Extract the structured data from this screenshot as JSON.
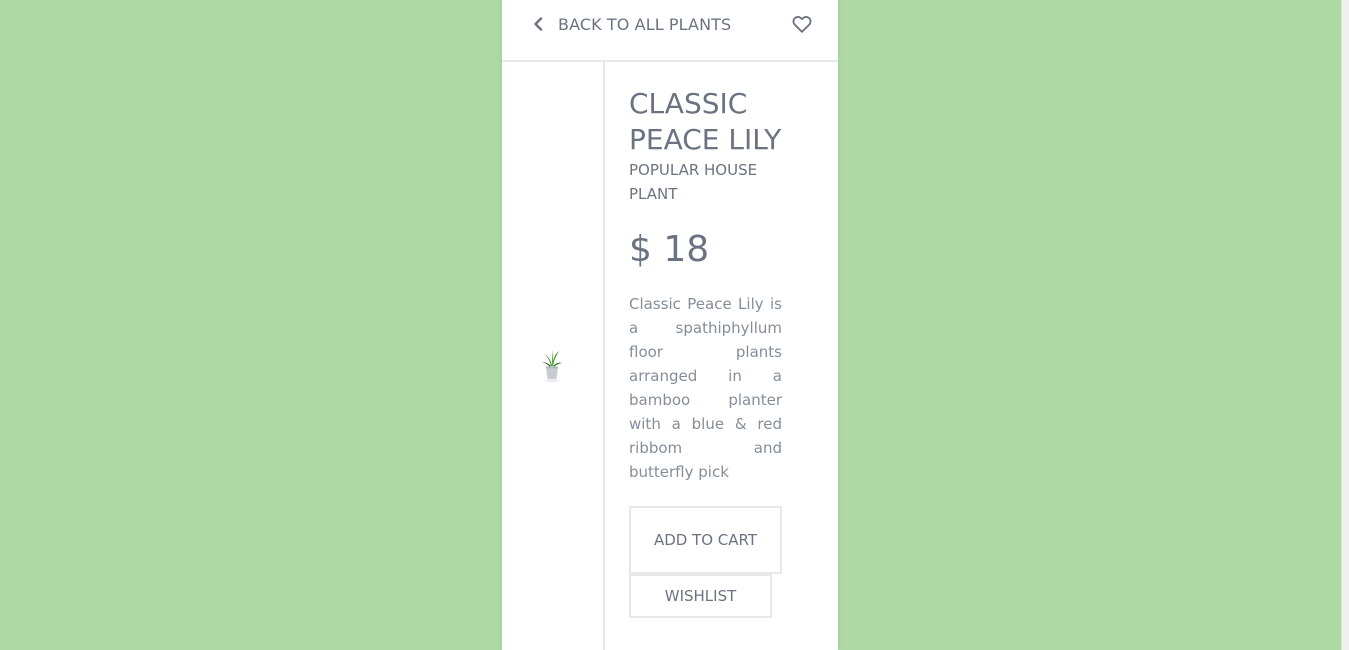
{
  "nav": {
    "back_label": "BACK TO ALL PLANTS",
    "back_icon": "chevron-left-icon",
    "wishlist_icon": "heart-icon"
  },
  "product": {
    "title": "CLASSIC PEACE LILY",
    "subtitle": "POPULAR HOUSE PLANT",
    "price": "$ 18",
    "description": "Classic Peace Lily is a spathiphyllum floor plants arranged in a bamboo planter with a blue & red ribbom and butterfly pick",
    "thumbnail": "plant-thumbnail"
  },
  "actions": {
    "add_to_cart_label": "ADD TO CART",
    "wishlist_label": "WISHLIST"
  },
  "colors": {
    "background": "#aed9a4",
    "card": "#ffffff",
    "text": "#6b7281",
    "border": "#e6e8ec"
  }
}
